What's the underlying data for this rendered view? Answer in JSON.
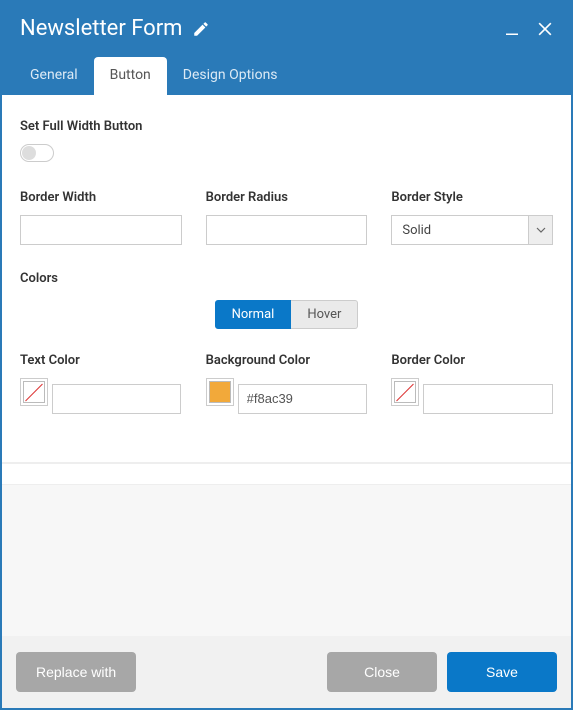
{
  "header": {
    "title": "Newsletter Form"
  },
  "tabs": {
    "general": "General",
    "button": "Button",
    "design_options": "Design Options"
  },
  "fields": {
    "full_width_label": "Set Full Width Button",
    "border_width_label": "Border Width",
    "border_width_value": "",
    "border_radius_label": "Border Radius",
    "border_radius_value": "",
    "border_style_label": "Border Style",
    "border_style_value": "Solid"
  },
  "colors": {
    "section_label": "Colors",
    "state_normal": "Normal",
    "state_hover": "Hover",
    "text_color_label": "Text Color",
    "text_color_value": "",
    "background_color_label": "Background Color",
    "background_color_value": "#f8ac39",
    "background_color_swatch": "#f2a93a",
    "border_color_label": "Border Color",
    "border_color_value": ""
  },
  "footer": {
    "replace_with": "Replace with",
    "close": "Close",
    "save": "Save"
  }
}
